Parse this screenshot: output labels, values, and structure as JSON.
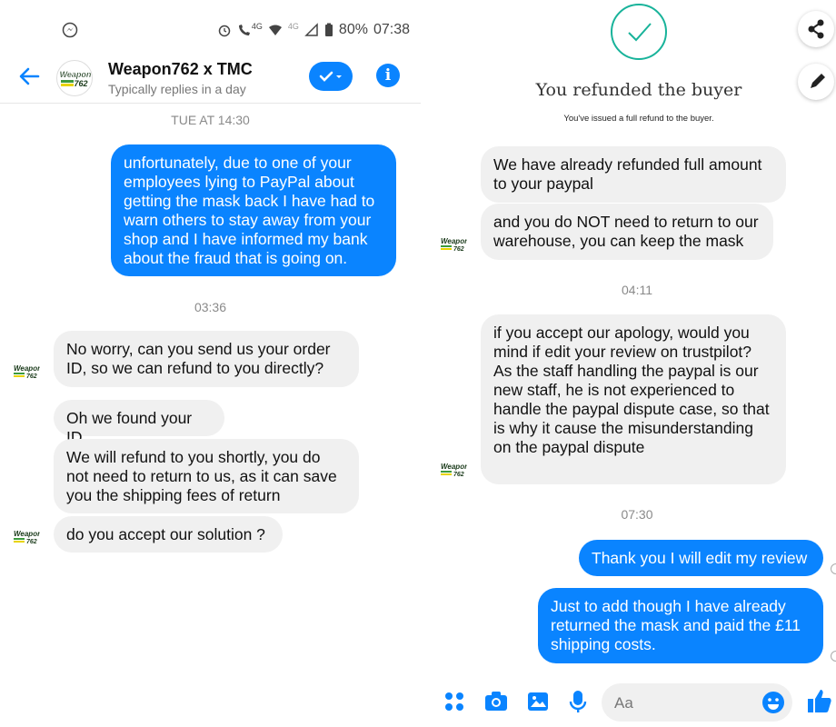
{
  "status_bar": {
    "battery": "80%",
    "time": "07:38",
    "network_1": "4G",
    "network_2": "4G"
  },
  "header": {
    "title": "Weapon762 x TMC",
    "subtitle": "Typically replies in a day"
  },
  "brand": {
    "logo_line1": "Weapon",
    "logo_line2": "762"
  },
  "left_conversation": {
    "ts1": "TUE AT 14:30",
    "msg1": "unfortunately, due to one of your employees lying to PayPal about getting the mask back I have had to warn others to stay away from your shop and I have informed my bank about the fraud that is going on.",
    "ts2": "03:36",
    "msg2": "No worry, can you send us your order ID, so we can refund to you directly?",
    "msg3": "Oh we found your ID",
    "msg4": "We will refund to you shortly, you do not need to return to us, as it can save you the shipping fees of return",
    "msg5": "do you accept our solution ?"
  },
  "right_conversation": {
    "refund_title": "You refunded the buyer",
    "refund_sub": "You've issued a full refund to the buyer.",
    "msg1": "We have already refunded full amount to your paypal",
    "msg2": "and you do NOT need to return to our warehouse, you can keep the mask",
    "ts1": "04:11",
    "msg3": "if you accept our apology, would you mind if edit your review on trustpilot? As the staff handling the paypal is our new staff, he is not experienced to handle the paypal dispute case, so that is why it cause the misunderstanding on the paypal dispute",
    "ts2": "07:30",
    "msg4": "Thank you I will edit my review",
    "msg5": "Just to add though I have already returned the mask and paid the £11 shipping costs."
  },
  "composer": {
    "placeholder": "Aa"
  },
  "colors": {
    "accent": "#0a84ff",
    "bubble_in": "#f0f0f0",
    "refund_check": "#18b39a",
    "like": "#0a84ff"
  }
}
